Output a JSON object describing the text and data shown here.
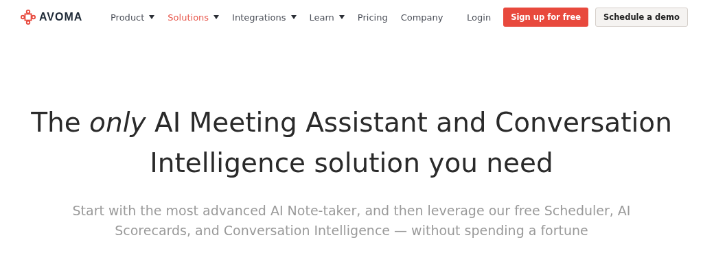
{
  "brand": {
    "name": "AVOMA"
  },
  "nav": [
    {
      "label": "Product",
      "dropdown": true,
      "selected": false
    },
    {
      "label": "Solutions",
      "dropdown": true,
      "selected": true
    },
    {
      "label": "Integrations",
      "dropdown": true,
      "selected": false
    },
    {
      "label": "Learn",
      "dropdown": true,
      "selected": false
    },
    {
      "label": "Pricing",
      "dropdown": false,
      "selected": false
    },
    {
      "label": "Company",
      "dropdown": false,
      "selected": false
    }
  ],
  "login": "Login",
  "buttons": [
    {
      "label": "Sign up for free",
      "kind": "primary"
    },
    {
      "label": "Schedule a demo",
      "kind": "secondary"
    }
  ],
  "hero": {
    "title": "The *only* AI Meeting Assistant and Conversation Intelligence solution you need",
    "subtitle": "Start with the most advanced AI Note-taker, and then leverage our free Scheduler, AI Scorecards, and Conversation Intelligence — without spending a fortune"
  }
}
